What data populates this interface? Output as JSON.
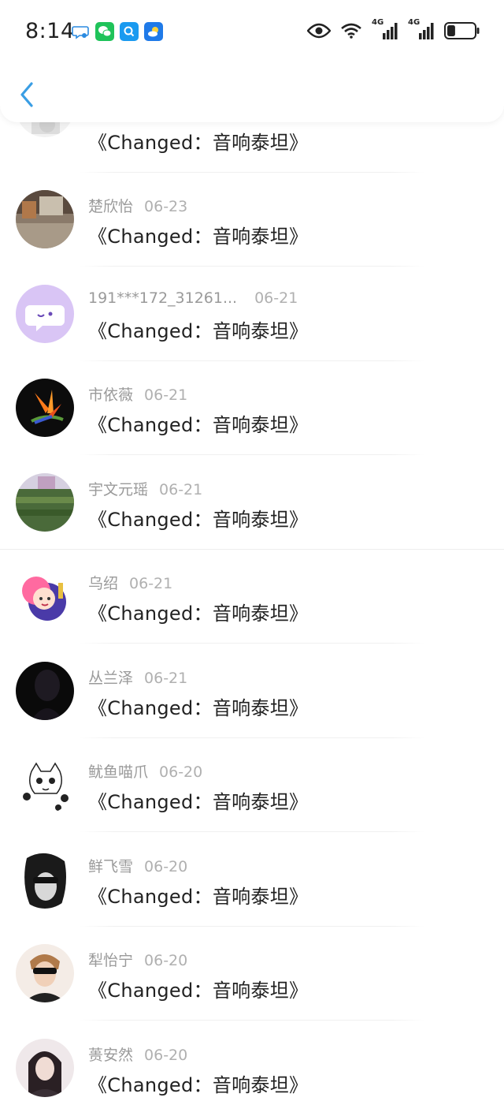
{
  "status_bar": {
    "time": "8:14",
    "notification_icons": [
      "message-bubble-icon",
      "wechat-icon",
      "search-app-icon",
      "weather-app-icon"
    ],
    "network_label_1": "4G",
    "network_label_2": "4G",
    "battery_level": 0.3
  },
  "header": {
    "back_icon": "chevron-left-icon",
    "accent_color": "#3a9ee4"
  },
  "comments": [
    {
      "name": "",
      "date": "",
      "message": "《Changed：音响泰坦》"
    },
    {
      "name": "楚欣怡",
      "date": "06-23",
      "message": "《Changed：音响泰坦》"
    },
    {
      "name": "191***172_31261...",
      "date": "06-21",
      "message": "《Changed：音响泰坦》"
    },
    {
      "name": "市依薇",
      "date": "06-21",
      "message": "《Changed：音响泰坦》"
    },
    {
      "name": "宇文元瑶",
      "date": "06-21",
      "message": "《Changed：音响泰坦》"
    },
    {
      "name": "乌绍",
      "date": "06-21",
      "message": "《Changed：音响泰坦》"
    },
    {
      "name": "丛兰泽",
      "date": "06-21",
      "message": "《Changed：音响泰坦》"
    },
    {
      "name": "鱿鱼喵爪",
      "date": "06-20",
      "message": "《Changed：音响泰坦》"
    },
    {
      "name": "鲜飞雪",
      "date": "06-20",
      "message": "《Changed：音响泰坦》"
    },
    {
      "name": "犁怡宁",
      "date": "06-20",
      "message": "《Changed：音响泰坦》"
    },
    {
      "name": "蒉安然",
      "date": "06-20",
      "message": "《Changed：音响泰坦》"
    }
  ]
}
